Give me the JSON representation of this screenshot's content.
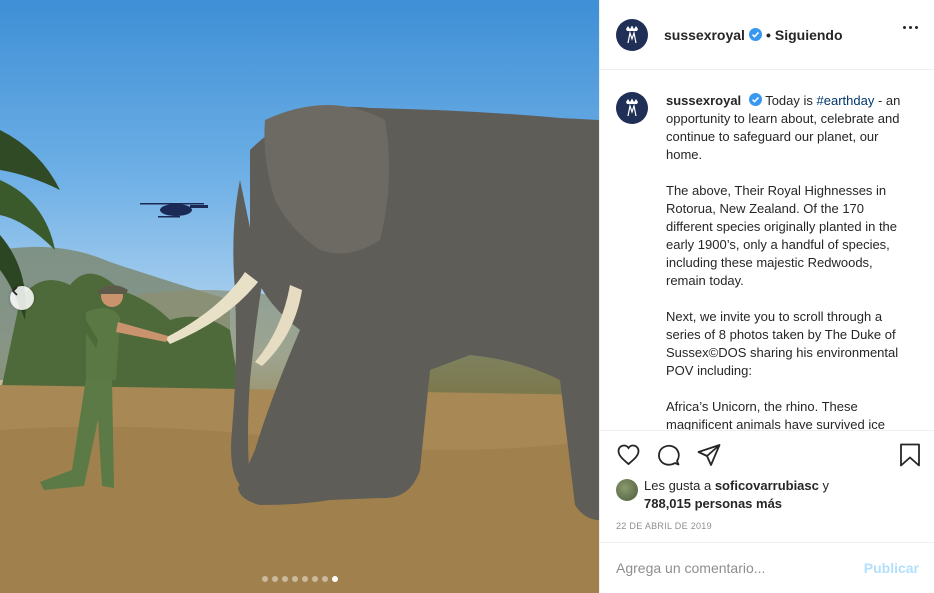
{
  "header": {
    "username": "sussexroyal",
    "separator": "•",
    "follow_status": "Siguiendo",
    "avatar_icon": "royal-monogram-icon",
    "more_icon": "more-options-icon"
  },
  "caption": {
    "username": "sussexroyal",
    "text_before_tag": "Today is ",
    "hashtag": "#earthday",
    "text_after_tag": " - an opportunity to learn about, celebrate and continue to safeguard our planet, our home.",
    "paragraph2": "The above, Their Royal Highnesses in Rotorua, New Zealand. Of the 170 different species originally planted in the early 1900’s, only a handful of species, including these majestic Redwoods, remain today.",
    "paragraph3": "Next, we invite you to scroll through a series of 8 photos taken by The Duke of Sussex©DOS sharing his environmental POV including:",
    "paragraph4": "Africa’s Unicorn, the rhino. These magnificent animals have survived ice"
  },
  "actions": {
    "like_icon": "heart-icon",
    "comment_icon": "comment-icon",
    "share_icon": "share-icon",
    "save_icon": "bookmark-icon"
  },
  "likes": {
    "prefix": "Les gusta a ",
    "first_user": "soficovarrubiasc",
    "middle": " y",
    "count_text": "788,015 personas más"
  },
  "date": "22 DE ABRIL DE 2019",
  "comment": {
    "placeholder": "Agrega un comentario...",
    "publish_label": "Publicar"
  },
  "carousel": {
    "total": 8,
    "active_index": 7
  },
  "colors": {
    "accent_link": "#00376b",
    "verified": "#3897f0",
    "publish_disabled": "#b2dffc",
    "avatar_bg": "#1f2f56"
  }
}
